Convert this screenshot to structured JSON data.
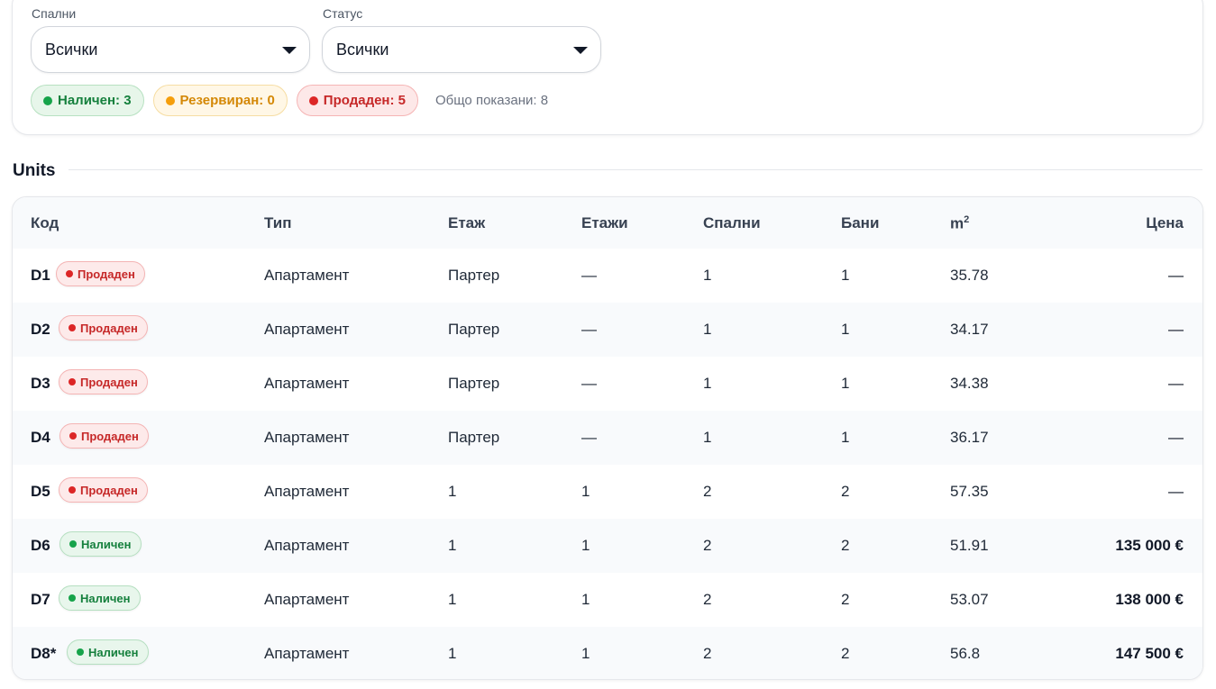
{
  "filters": {
    "bedrooms": {
      "label": "Спални",
      "value": "Всички"
    },
    "status": {
      "label": "Статус",
      "value": "Всички"
    },
    "chips": [
      {
        "label": "Наличен: 3",
        "color": "#16a34a"
      },
      {
        "label": "Резервиран: 0",
        "color": "#f59e0b"
      },
      {
        "label": "Продаден: 5",
        "color": "#dc2626"
      }
    ],
    "total": "Общо показани: 8"
  },
  "section": {
    "title": "Units"
  },
  "table": {
    "headers": [
      "Код",
      "Тип",
      "Етаж",
      "Етажи",
      "Спални",
      "Бани",
      "m",
      "Цена"
    ],
    "area_sup": "2",
    "rows": [
      {
        "code": "D1",
        "status": "Продаден",
        "status_kind": "sold",
        "type": "Апартамент",
        "floor": "Партер",
        "floors": "—",
        "bedrooms": "1",
        "baths": "1",
        "area": "35.78",
        "price": "—"
      },
      {
        "code": "D2",
        "status": "Продаден",
        "status_kind": "sold",
        "type": "Апартамент",
        "floor": "Партер",
        "floors": "—",
        "bedrooms": "1",
        "baths": "1",
        "area": "34.17",
        "price": "—"
      },
      {
        "code": "D3",
        "status": "Продаден",
        "status_kind": "sold",
        "type": "Апартамент",
        "floor": "Партер",
        "floors": "—",
        "bedrooms": "1",
        "baths": "1",
        "area": "34.38",
        "price": "—"
      },
      {
        "code": "D4",
        "status": "Продаден",
        "status_kind": "sold",
        "type": "Апартамент",
        "floor": "Партер",
        "floors": "—",
        "bedrooms": "1",
        "baths": "1",
        "area": "36.17",
        "price": "—"
      },
      {
        "code": "D5",
        "status": "Продаден",
        "status_kind": "sold",
        "type": "Апартамент",
        "floor": "1",
        "floors": "1",
        "bedrooms": "2",
        "baths": "2",
        "area": "57.35",
        "price": "—"
      },
      {
        "code": "D6",
        "status": "Наличен",
        "status_kind": "avail",
        "type": "Апартамент",
        "floor": "1",
        "floors": "1",
        "bedrooms": "2",
        "baths": "2",
        "area": "51.91",
        "price": "135 000 €"
      },
      {
        "code": "D7",
        "status": "Наличен",
        "status_kind": "avail",
        "type": "Апартамент",
        "floor": "1",
        "floors": "1",
        "bedrooms": "2",
        "baths": "2",
        "area": "53.07",
        "price": "138 000 €"
      },
      {
        "code": "D8*",
        "status": "Наличен",
        "status_kind": "avail",
        "type": "Апартамент",
        "floor": "1",
        "floors": "1",
        "bedrooms": "2",
        "baths": "2",
        "area": "56.8",
        "price": "147 500 €"
      }
    ]
  }
}
